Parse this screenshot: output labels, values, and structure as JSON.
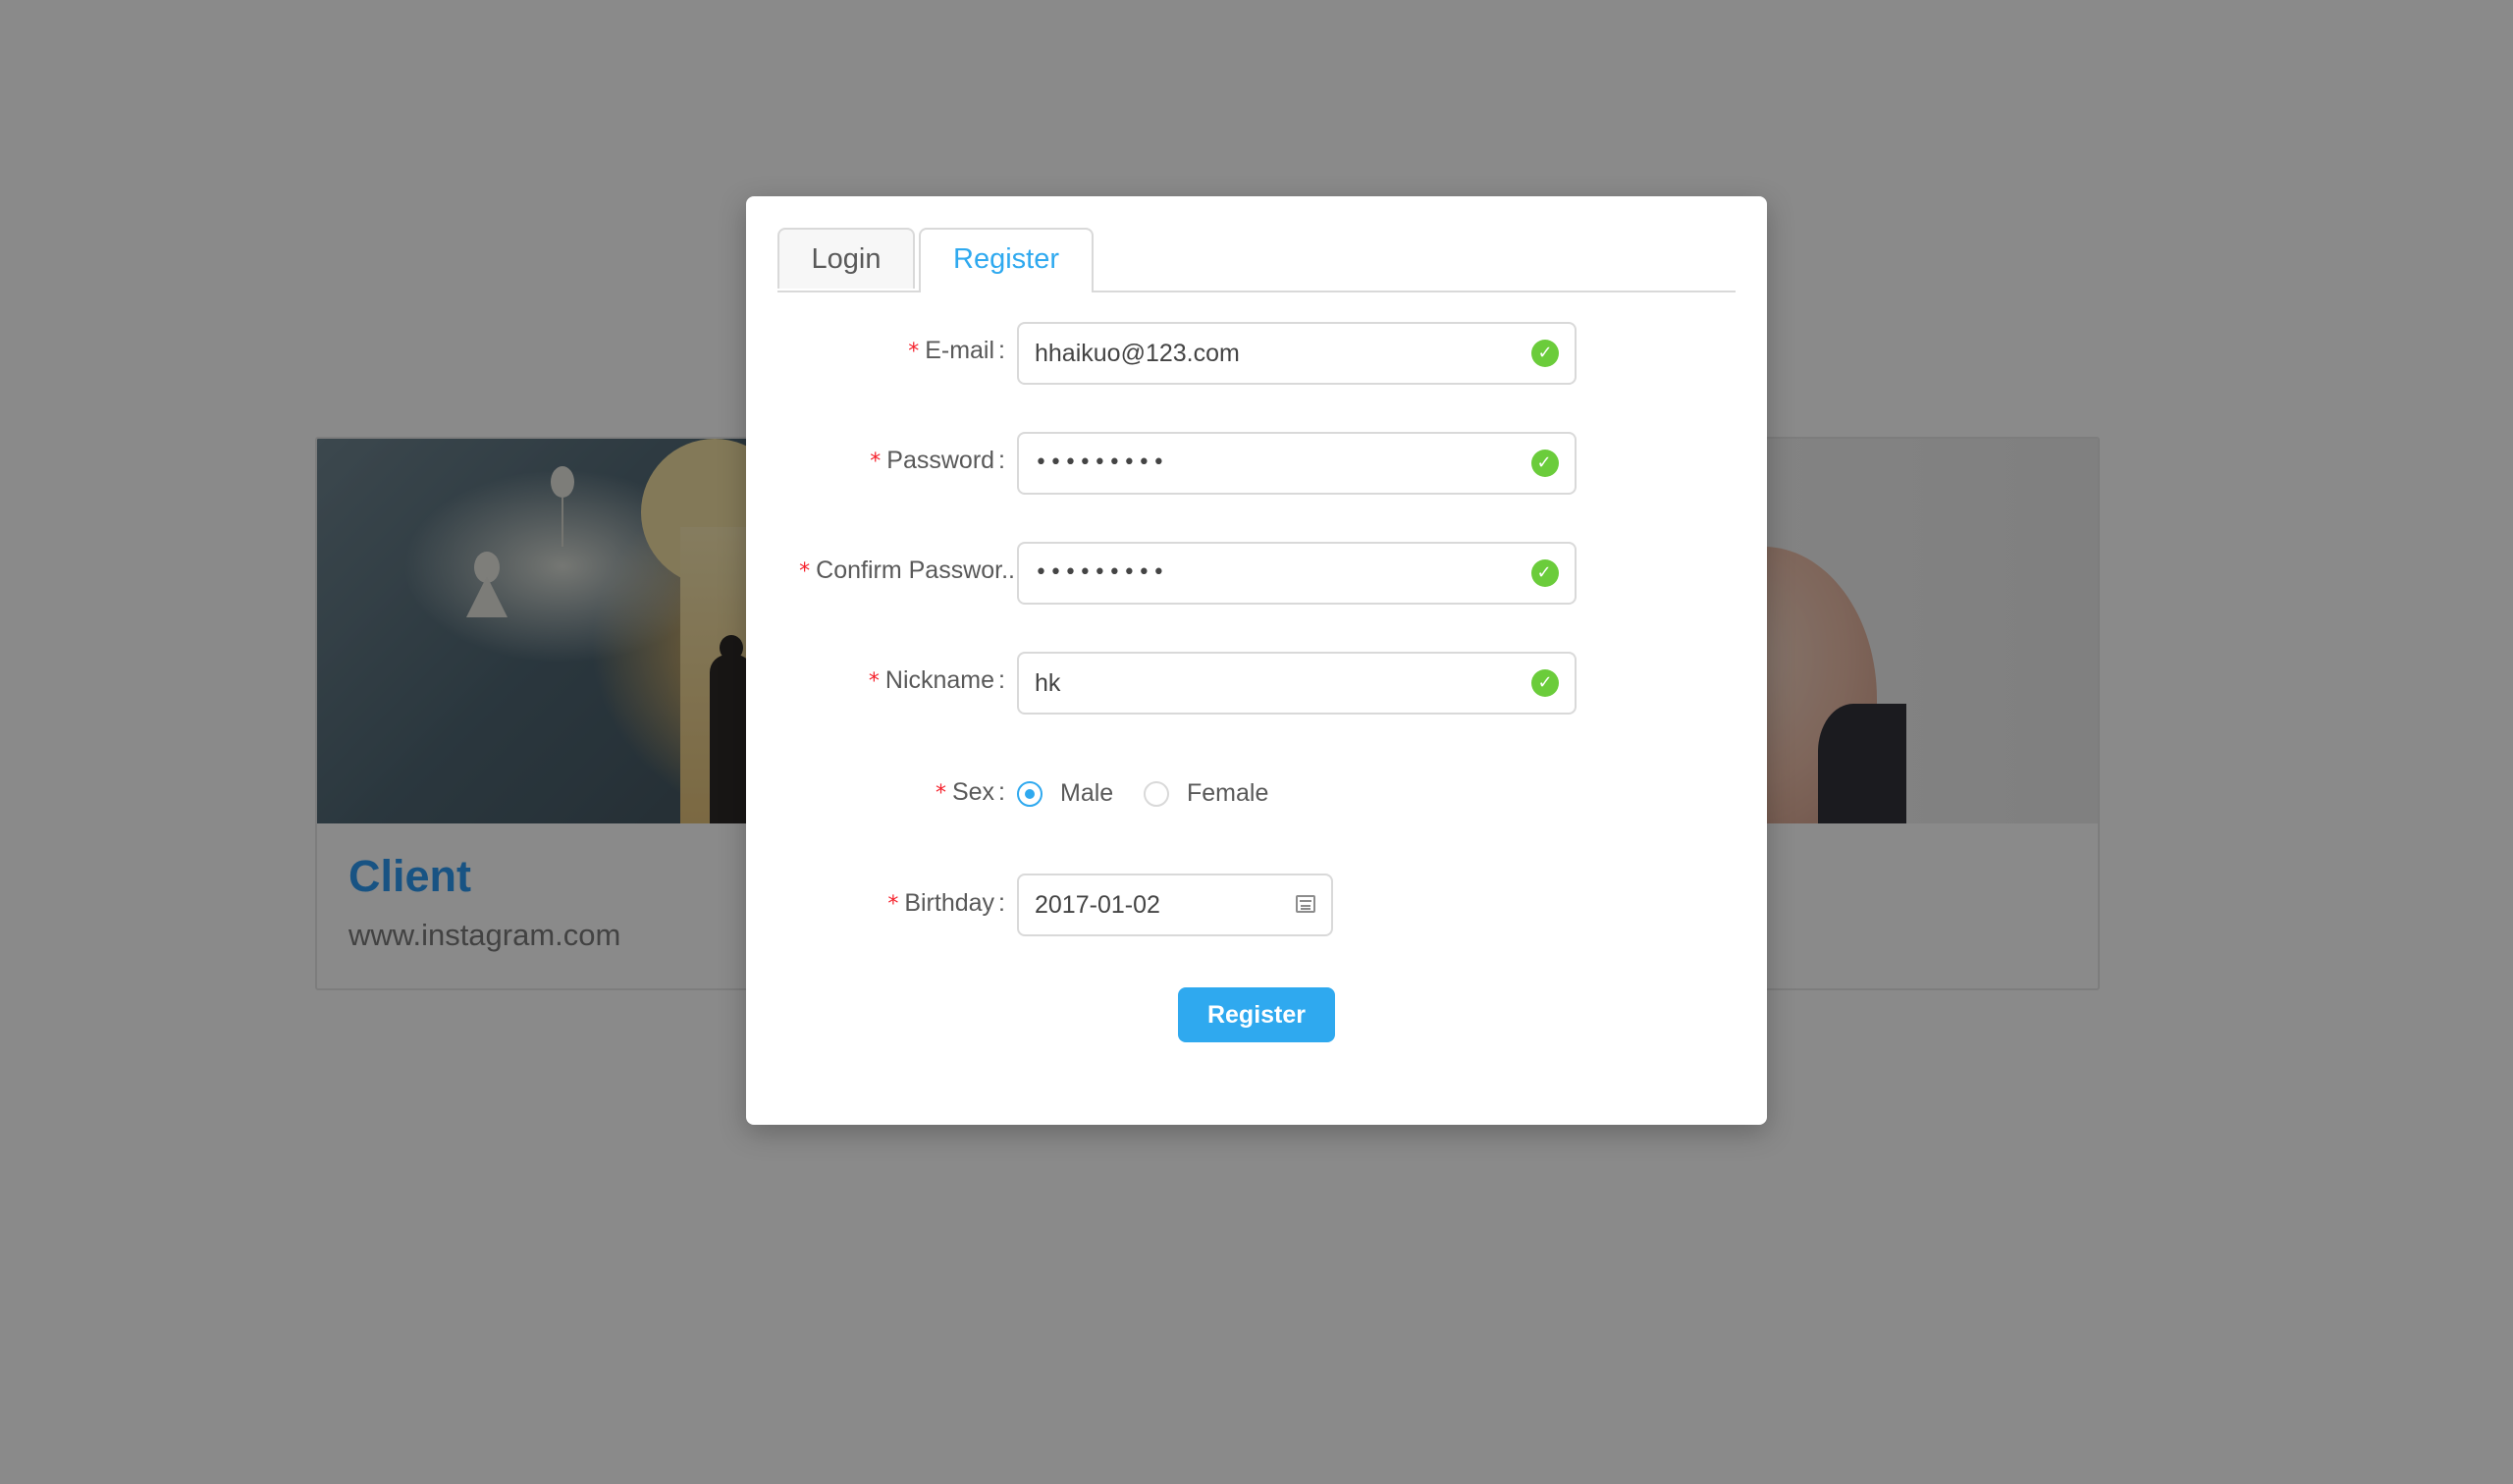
{
  "background": {
    "cards": [
      {
        "title": "Client",
        "subtitle": "www.instagram.com"
      }
    ]
  },
  "modal": {
    "tabs": [
      {
        "label": "Login",
        "active": false
      },
      {
        "label": "Register",
        "active": true
      }
    ],
    "form": {
      "email": {
        "label": "E-mail",
        "value": "hhaikuo@123.com",
        "valid": true
      },
      "password": {
        "label": "Password",
        "value": "•••••••••",
        "valid": true
      },
      "confirm_password": {
        "label": "Confirm Passwor..",
        "value": "•••••••••",
        "valid": true
      },
      "nickname": {
        "label": "Nickname",
        "value": "hk",
        "valid": true
      },
      "sex": {
        "label": "Sex",
        "options": [
          "Male",
          "Female"
        ],
        "selected": "Male"
      },
      "birthday": {
        "label": "Birthday",
        "value": "2017-01-02"
      },
      "required_mark": "*",
      "colon": ":"
    },
    "submit_label": "Register"
  },
  "colors": {
    "accent": "#2fa9ef",
    "success": "#52c41a",
    "required": "#f5222d",
    "overlay": "rgba(0,0,0,0.46)"
  },
  "icons": {
    "valid": "check-circle-icon",
    "calendar": "calendar-icon"
  }
}
